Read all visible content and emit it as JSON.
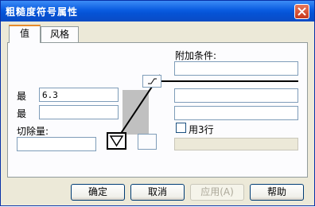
{
  "window": {
    "title": "粗糙度符号属性",
    "close_label": "close"
  },
  "tabs": [
    {
      "label": "值",
      "active": true
    },
    {
      "label": "风格",
      "active": false
    }
  ],
  "labels": {
    "extra_conditions": "附加条件:",
    "max_label": "最",
    "min_label": "最",
    "cutoff": "切除量:",
    "use3lines": "用3行"
  },
  "fields": {
    "max_value": "6.3",
    "min_value": "",
    "cutoff_value": "",
    "extra_1": "",
    "extra_2": "",
    "extra_3": ""
  },
  "checkbox": {
    "use3lines_checked": false
  },
  "buttons": {
    "ok": "确定",
    "cancel": "取消",
    "apply": "应用(A)",
    "help": "帮助"
  },
  "colors": {
    "titlebar": "#0553d6",
    "accent": "#e68b2c"
  }
}
